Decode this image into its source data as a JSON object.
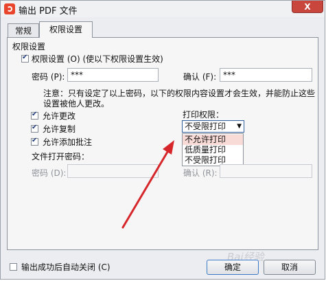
{
  "window": {
    "title": "输出 PDF 文件",
    "close_label": "X"
  },
  "tabs": [
    {
      "label": "常规"
    },
    {
      "label": "权限设置"
    }
  ],
  "group_title": "权限设置",
  "permission": {
    "enable_label": "权限设置 (O) (使以下权限设置生效)",
    "password_label": "密码 (P):",
    "password_value": "***",
    "confirm_label": "确认 (F):",
    "confirm_value": "***",
    "note": "注意：只有设定了以上密码，以下的权限内容设置才会生效，并能防止这些设置被他人更改。",
    "allow_change": "允许更改",
    "allow_copy": "允许复制",
    "allow_annotate": "允许添加批注",
    "print_label": "打印权限：",
    "print_selected": "不受限打印",
    "print_options": [
      "不允许打印",
      "低质量打印",
      "不受限打印"
    ],
    "open_password_title": "文件打开密码：",
    "open_password_label": "密码 (D):",
    "open_confirm_label": "确认 (R):"
  },
  "footer": {
    "auto_close_label": "输出成功后自动关闭 (C)",
    "ok_label": "确定",
    "cancel_label": "取消"
  },
  "watermark_text": "Bai经验",
  "colors": {
    "close": "#c9463d",
    "accent": "#2e5c9a",
    "arrow": "#d6262a",
    "highlight": "#f8dad6"
  }
}
